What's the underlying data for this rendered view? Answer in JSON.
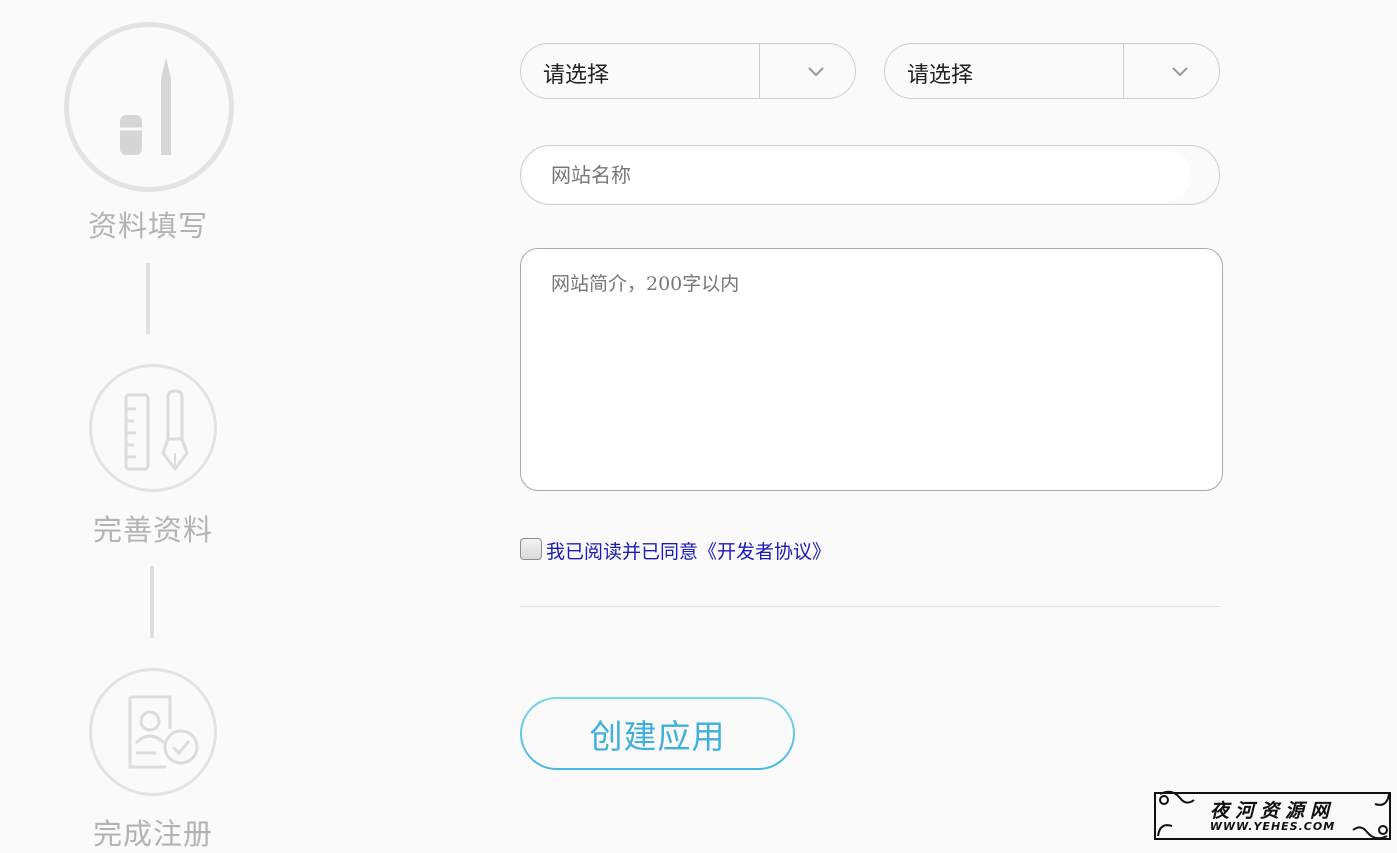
{
  "steps": [
    {
      "label": "资料填写",
      "icon": "pencil-eraser-icon",
      "active": true
    },
    {
      "label": "完善资料",
      "icon": "ruler-pen-icon",
      "active": false
    },
    {
      "label": "完成注册",
      "icon": "profile-check-icon",
      "active": false
    }
  ],
  "form": {
    "select_1": {
      "value": "请选择"
    },
    "select_2": {
      "value": "请选择"
    },
    "site_name": {
      "placeholder": "网站名称",
      "value": ""
    },
    "site_intro": {
      "placeholder": "网站简介，200字以内",
      "value": ""
    },
    "agreement": {
      "label": "我已阅读并已同意《开发者协议》",
      "checked": false
    },
    "submit_label": "创建应用"
  },
  "watermark": {
    "name": "夜河资源网",
    "url": "WWW.YEHES.COM"
  },
  "colors": {
    "background": "#fafafa",
    "step_gray": "#b3b3b3",
    "agreement_link": "#1a1ab8",
    "button_text": "#3fb0dc",
    "button_border": "#4ab6e6"
  }
}
